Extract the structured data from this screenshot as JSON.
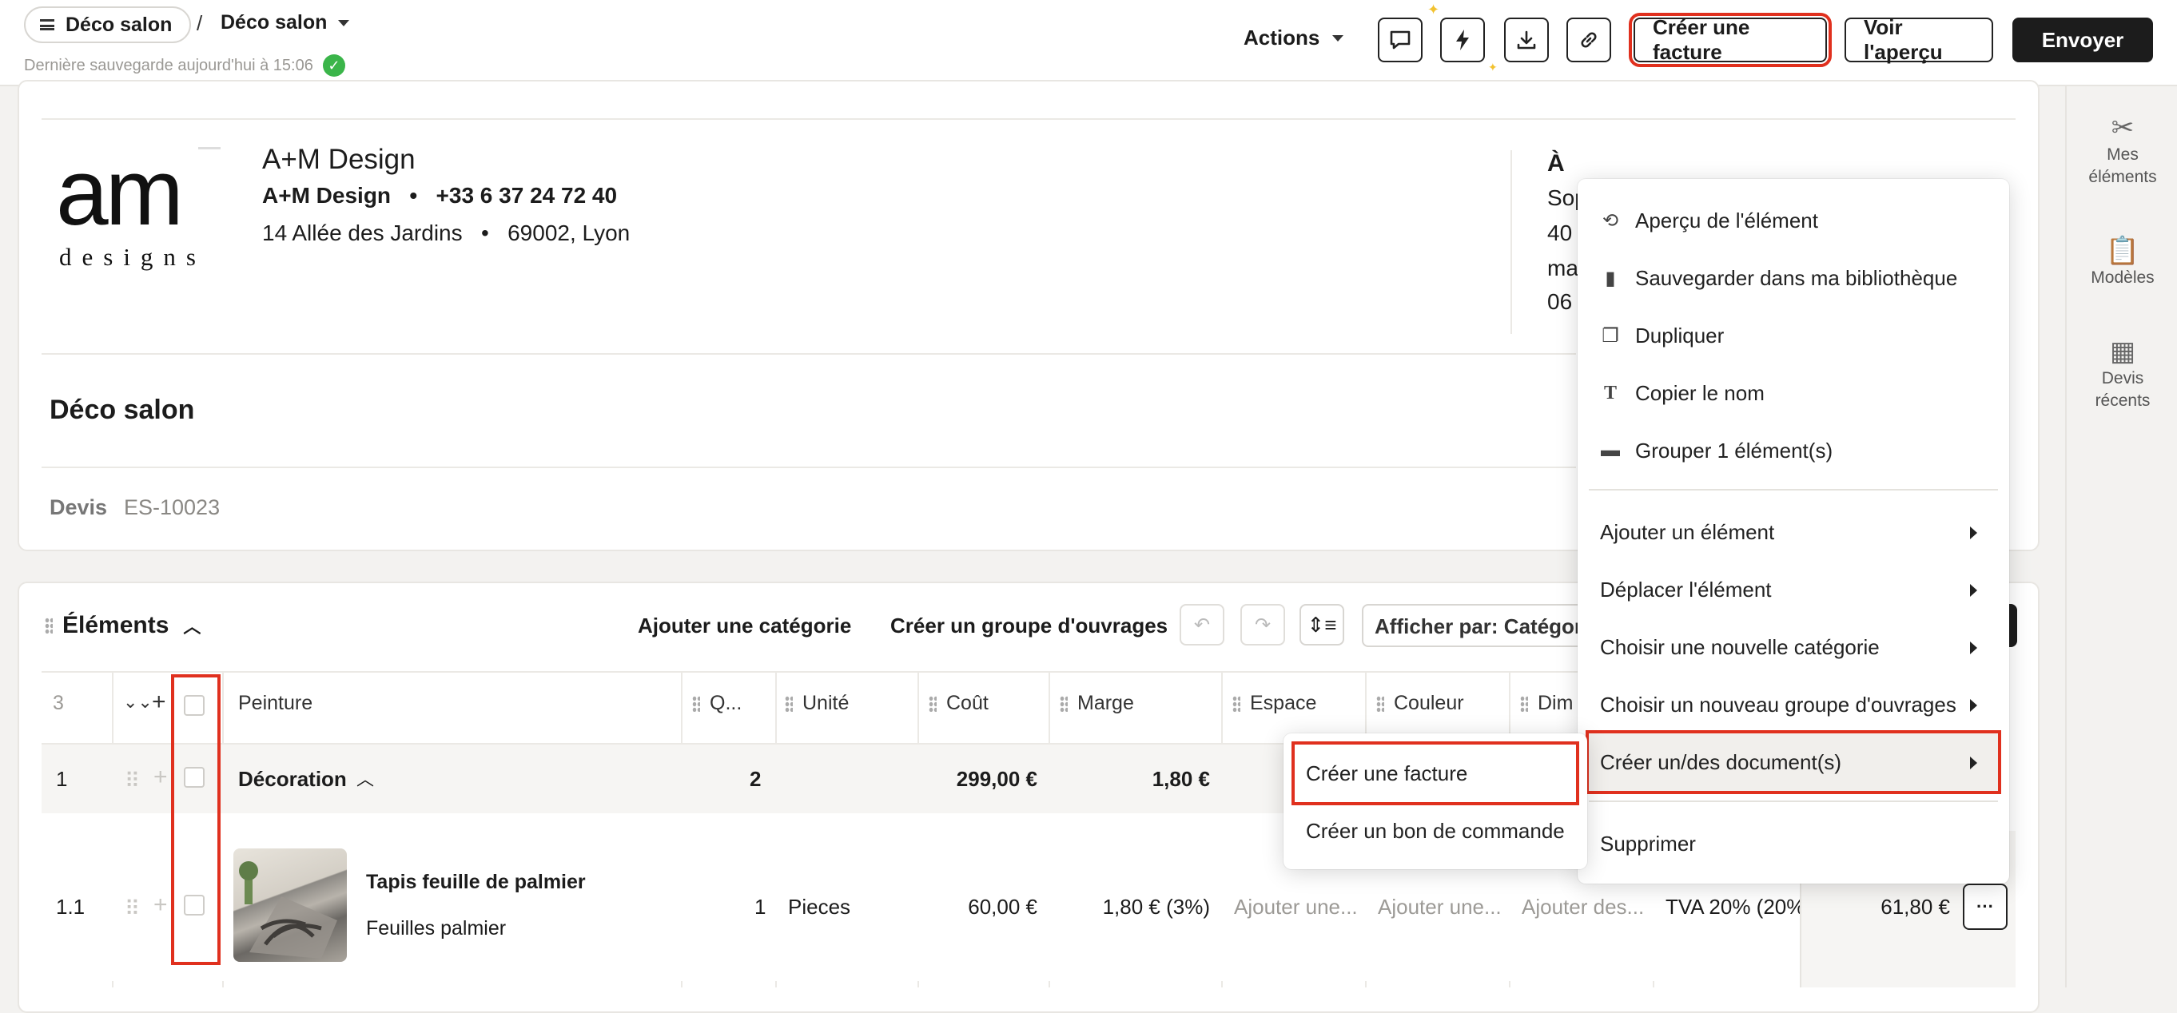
{
  "header": {
    "breadcrumb_root": "Déco salon",
    "breadcrumb_separator": "/",
    "breadcrumb_current": "Déco salon",
    "saved_text": "Dernière sauvegarde aujourd'hui à 15:06",
    "actions_label": "Actions",
    "create_invoice_label": "Créer une facture",
    "preview_label": "Voir l'aperçu",
    "send_label": "Envoyer",
    "icons": [
      "comment-icon",
      "lightning-icon",
      "download-icon",
      "link-icon"
    ]
  },
  "sidebar": {
    "items": [
      {
        "label_1": "Mes",
        "label_2": "éléments",
        "icon": "tools-icon"
      },
      {
        "label_1": "Modèles",
        "icon": "clipboard-icon"
      },
      {
        "label_1": "Devis",
        "label_2": "récents",
        "icon": "calculator-icon"
      }
    ]
  },
  "company": {
    "logo_text": "am",
    "logo_sub": "designs",
    "name": "A+M Design",
    "line2_name": "A+M Design",
    "phone": "+33 6 37 24 72 40",
    "address": "14 Allée des Jardins",
    "city": "69002, Lyon",
    "bullet": "•"
  },
  "recipient": {
    "label": "À",
    "lines": [
      "Sop",
      "40",
      "ma",
      "06"
    ]
  },
  "document": {
    "title": "Déco salon",
    "type_label": "Devis",
    "number": "ES-10023"
  },
  "elements": {
    "title": "Éléments",
    "add_category": "Ajouter une catégorie",
    "create_group": "Créer un groupe d'ouvrages",
    "display_by": "Afficher par: Catégori",
    "columns": {
      "count": "3",
      "name": "Peinture",
      "qty": "Q...",
      "unit": "Unité",
      "cost": "Coût",
      "margin": "Marge",
      "space": "Espace",
      "color": "Couleur",
      "dim": "Dim"
    },
    "rows": [
      {
        "num": "1",
        "name": "Décoration",
        "qty": "2",
        "cost": "299,00 €",
        "margin": "1,80 €"
      },
      {
        "num": "1.1",
        "name": "Tapis feuille de palmier",
        "desc": "Feuilles palmier",
        "qty": "1",
        "unit": "Pieces",
        "cost": "60,00 €",
        "margin": "1,80 € (3%)",
        "space": "Ajouter une...",
        "color": "Ajouter une...",
        "dim": "Ajouter des...",
        "tva": "TVA 20% (20%",
        "total": "61,80 €",
        "more": "···"
      }
    ]
  },
  "context_menu": {
    "items": [
      {
        "label": "Aperçu de l'élément",
        "icon": "preview-icon"
      },
      {
        "label": "Sauvegarder dans ma bibliothèque",
        "icon": "book-icon"
      },
      {
        "label": "Dupliquer",
        "icon": "duplicate-icon"
      },
      {
        "label": "Copier le nom",
        "icon": "text-icon"
      },
      {
        "label": "Grouper 1 élément(s)",
        "icon": "folder-icon"
      }
    ],
    "submenus": [
      "Ajouter un élément",
      "Déplacer l'élément",
      "Choisir une nouvelle catégorie",
      "Choisir un nouveau groupe d'ouvrages",
      "Créer un/des document(s)"
    ],
    "delete": "Supprimer"
  },
  "sub_menu": {
    "items": [
      "Créer une facture",
      "Créer un bon de commande"
    ]
  },
  "colors": {
    "highlight": "#e0301e",
    "success": "#3bb54a",
    "dark": "#1c1c1c"
  }
}
